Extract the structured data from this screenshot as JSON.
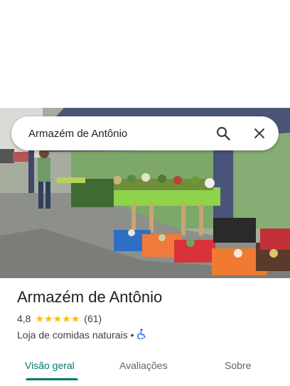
{
  "search": {
    "query": "Armazém de Antônio"
  },
  "icons": {
    "search": "search-icon",
    "close": "close-icon",
    "accessibility": "wheelchair-accessible-icon",
    "star": "star-icon"
  },
  "place": {
    "name": "Armazém de Antônio",
    "rating": "4,8",
    "rating_stars": 4.8,
    "star_glyph": "★",
    "reviews": "(61)",
    "category": "Loja de comidas naturais",
    "separator": "•"
  },
  "tabs": [
    {
      "label": "Visão geral",
      "active": true
    },
    {
      "label": "Avaliações",
      "active": false
    },
    {
      "label": "Sobre",
      "active": false
    }
  ],
  "colors": {
    "accent": "#00796b",
    "star": "#fbbc04",
    "accessible": "#1a73e8"
  }
}
